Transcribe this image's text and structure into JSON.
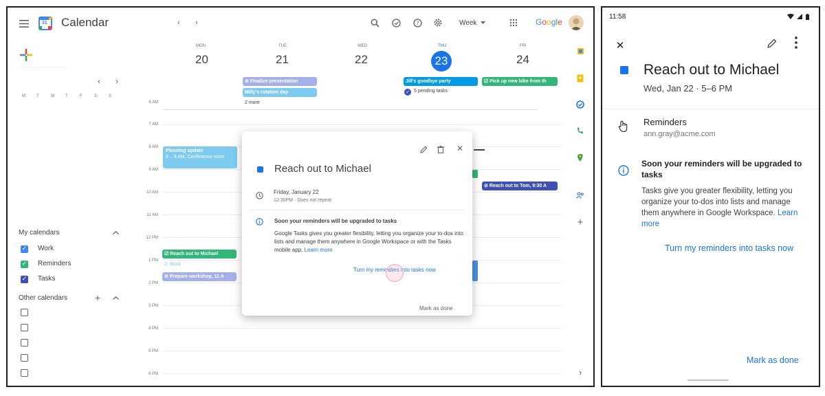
{
  "desktop": {
    "app_name": "Calendar",
    "calendar_icon_date": "31",
    "view_label": "Week",
    "brand": "Google",
    "days": [
      {
        "dow": "MON",
        "date": "20"
      },
      {
        "dow": "TUE",
        "date": "21"
      },
      {
        "dow": "WED",
        "date": "22"
      },
      {
        "dow": "THU",
        "date": "23"
      },
      {
        "dow": "FRI",
        "date": "24"
      }
    ],
    "mini_weekdays": [
      "M",
      "T",
      "W",
      "T",
      "F",
      "S",
      "S"
    ],
    "times": [
      "6 AM",
      "7 AM",
      "8 AM",
      "9 AM",
      "10 AM",
      "11 AM",
      "12 PM",
      "1 PM",
      "2 PM",
      "3 PM",
      "4 PM",
      "5 PM",
      "6 PM"
    ],
    "my_calendars": {
      "title": "My calendars",
      "items": [
        {
          "label": "Work",
          "color": "#4285f4"
        },
        {
          "label": "Reminders",
          "color": "#33b679"
        },
        {
          "label": "Tasks",
          "color": "#3f51b5"
        }
      ]
    },
    "other_calendars": {
      "title": "Other calendars"
    },
    "events": {
      "finalize": "Finalize presentation",
      "milly": "Milly's rotation day",
      "more": "2 more",
      "jills": "Jill's goodbye party",
      "pending": "5 pending tasks",
      "pickup": "Pick up new bike from th",
      "planning_title": "Planning update",
      "planning_detail": "8 – 9 AM, Conference room",
      "reach_tom": "Reach out to Tom, 9:30 A",
      "reach_michael": "Reach out to Michael",
      "book": "Book",
      "prepare": "Prepare workshop, 11 A"
    },
    "popup": {
      "title": "Reach out to Michael",
      "date": "Friday, January 22",
      "recurrence": "12:30PM · Does not repeat",
      "notice_title": "Soon your reminders will be upgraded to tasks",
      "notice_body": "Google Tasks gives you greater flexibility, letting you organize your to-dos into lists and manage them anywhere in Google Workspace or with the Tasks mobile app.",
      "learn_more": "Learn more",
      "cta": "Turn my reminders into tasks now",
      "mark_done": "Mark as done"
    }
  },
  "phone": {
    "clock": "11:58",
    "title": "Reach out to Michael",
    "when": "Wed, Jan 22 · 5–6 PM",
    "section": "Reminders",
    "account": "ann.gray@acme.com",
    "notice_title": "Soon your reminders will be upgraded to tasks",
    "notice_body": "Tasks give you greater flexibility, letting you organize your to-dos into lists and manage them anywhere in Google Workspace.",
    "learn_more": "Learn more",
    "cta": "Turn my reminders into tasks now",
    "mark_done": "Mark as done"
  },
  "colors": {
    "accent": "#1a73e8",
    "today": "#1a73e8",
    "reminder_green": "#33b679",
    "lavender": "#7986cb",
    "peacock": "#039be5",
    "event_blue": "#3f51b5"
  }
}
